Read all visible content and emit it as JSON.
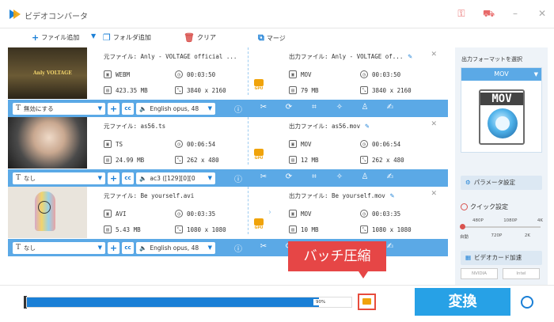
{
  "app": {
    "title": "ビデオコンバータ"
  },
  "toolbar": {
    "add_file": "ファイル追加",
    "add_folder": "フォルダ追加",
    "clear": "クリア",
    "merge": "マージ"
  },
  "items": [
    {
      "src_name": "元ファイル: Anly - VOLTAGE official ...",
      "src_format": "WEBM",
      "src_duration": "00:03:50",
      "src_size": "423.35 MB",
      "src_resolution": "3840 x 2160",
      "out_name": "出力ファイル: Anly - VOLTAGE of...",
      "out_format": "MOV",
      "out_duration": "00:03:50",
      "out_size": "79 MB",
      "out_resolution": "3840 x 2160",
      "subtitle": "無効にする",
      "audio": "English opus, 48",
      "thumb_text": "Anly VOLTAGE"
    },
    {
      "src_name": "元ファイル: as56.ts",
      "src_format": "TS",
      "src_duration": "00:06:54",
      "src_size": "24.99 MB",
      "src_resolution": "262 x 480",
      "out_name": "出力ファイル: as56.mov",
      "out_format": "MOV",
      "out_duration": "00:06:54",
      "out_size": "12 MB",
      "out_resolution": "262 x 480",
      "subtitle": "なし",
      "audio": "ac3 ([129][0][0",
      "thumb_text": ""
    },
    {
      "src_name": "元ファイル: Be yourself.avi",
      "src_format": "AVI",
      "src_duration": "00:03:35",
      "src_size": "5.43 MB",
      "src_resolution": "1080 x 1080",
      "out_name": "出力ファイル: Be yourself.mov",
      "out_format": "MOV",
      "out_duration": "00:03:35",
      "out_size": "10 MB",
      "out_resolution": "1080 x 1080",
      "subtitle": "なし",
      "audio": "English opus, 48",
      "thumb_text": ""
    }
  ],
  "gpu_label": "GPU",
  "sidebar": {
    "select_format": "出力フォーマットを選択",
    "format": "MOV",
    "icon_label": "MOV",
    "param_settings": "パラメータ設定",
    "quick_settings": "クイック設定",
    "quality_top": [
      "480P",
      "1080P",
      "4K"
    ],
    "quality_bottom": [
      "自動",
      "720P",
      "2K"
    ],
    "hw_accel": "ビデオカード加速",
    "vendors": [
      "NVIDIA",
      "Intel"
    ]
  },
  "bottom": {
    "progress_pct": "90%",
    "progress_value": 0.9,
    "convert": "変換"
  },
  "callout": "バッチ圧縮",
  "colors": {
    "accent": "#1a7fd6",
    "toolbar_blue": "#5ba9e6",
    "convert": "#27a1e6",
    "callout": "#e64646"
  }
}
